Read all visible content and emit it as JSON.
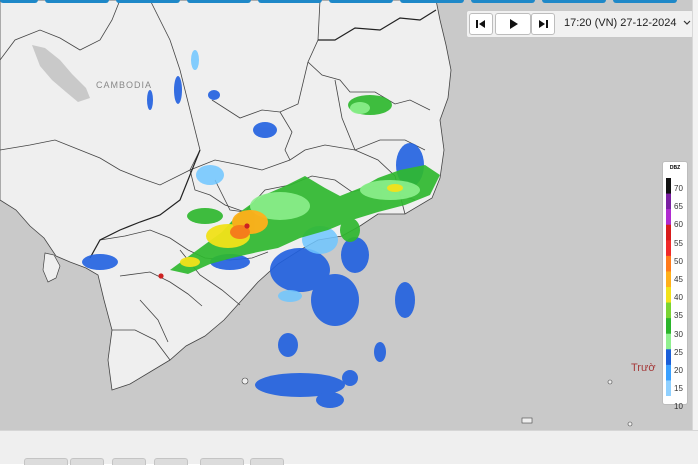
{
  "player": {
    "time_text": "17:20 (VN) 27-12-2024",
    "dropdown_glyph": "⌵",
    "buttons": {
      "prev_icon": "skip-back-icon",
      "play_icon": "play-icon",
      "next_icon": "skip-forward-icon"
    }
  },
  "map": {
    "labels": {
      "cambodia": "CAMBODIA",
      "truong_sa": "Trườ"
    },
    "colors": {
      "sea": "#c9c9c9",
      "land": "#efefef",
      "border": "#333333",
      "city_marker": "#cc2222"
    }
  },
  "legend": {
    "unit": "DBZ",
    "ticks": [
      "70",
      "65",
      "60",
      "55",
      "50",
      "45",
      "40",
      "35",
      "30",
      "25",
      "20",
      "15",
      "10"
    ],
    "colors": [
      "#111111",
      "#7a1fa2",
      "#b02bd0",
      "#d81b1b",
      "#f02a2a",
      "#ff7a1a",
      "#ffb01a",
      "#f2e21a",
      "#7ad432",
      "#2bb52b",
      "#8ff08f",
      "#1a5fd9",
      "#3aa0ff",
      "#8fd0ff"
    ]
  }
}
